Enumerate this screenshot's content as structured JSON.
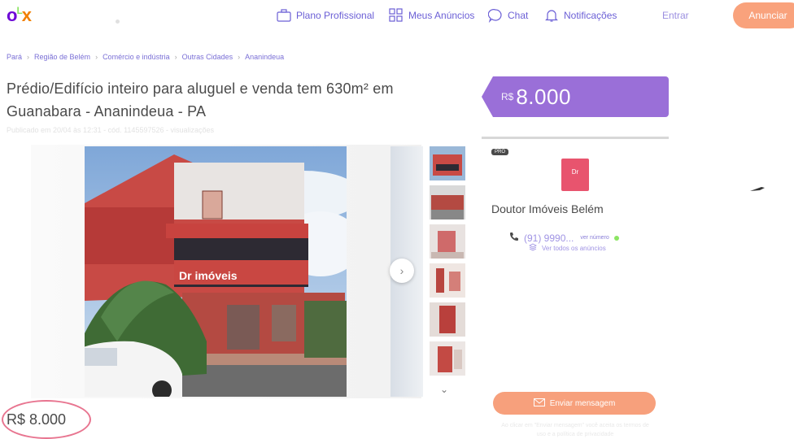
{
  "header": {
    "logo": {
      "o": "o",
      "l": "L",
      "x": "x"
    },
    "nav": [
      {
        "label": "Plano Profissional",
        "icon": "briefcase-icon"
      },
      {
        "label": "Meus Anúncios",
        "icon": "grid-icon"
      },
      {
        "label": "Chat",
        "icon": "chat-bubble-icon"
      },
      {
        "label": "Notificações",
        "icon": "bell-icon"
      }
    ],
    "login_label": "Entrar",
    "post_ad_label": "Anunciar"
  },
  "breadcrumb": [
    "Pará",
    "Região de Belém",
    "Comércio e indústria",
    "Outras Cidades",
    "Ananindeua"
  ],
  "breadcrumb_separator": "›",
  "listing": {
    "title": "Prédio/Edifício inteiro para aluguel e venda tem 630m² em Guanabara - Ananindeua - PA",
    "meta": "Publicado em 20/04 às 12:31 - cód. 1145597526 - visualizações",
    "price_bottom": "R$ 8.000",
    "photo_sign": "Dr imóveis"
  },
  "price_tag": {
    "currency": "R$",
    "value": "8.000"
  },
  "seller": {
    "badge": "PRO",
    "logo_text": "Dr",
    "name": "Doutor Imóveis Belém",
    "phone": "(91) 9990...",
    "reveal_label": "ver número",
    "all_ads_label": "Ver todos os anúncios"
  },
  "message_button_label": "Enviar mensagem",
  "disclaimer": "Ao clicar em \"Enviar mensagem\" você aceita os termos de uso e a política de privacidade",
  "colors": {
    "brand_purple": "#6e0ad6",
    "brand_orange": "#f28000",
    "price_tag": "#9a6fd8",
    "button_orange": "#f7a07c",
    "annotation_circle": "#e87590"
  }
}
